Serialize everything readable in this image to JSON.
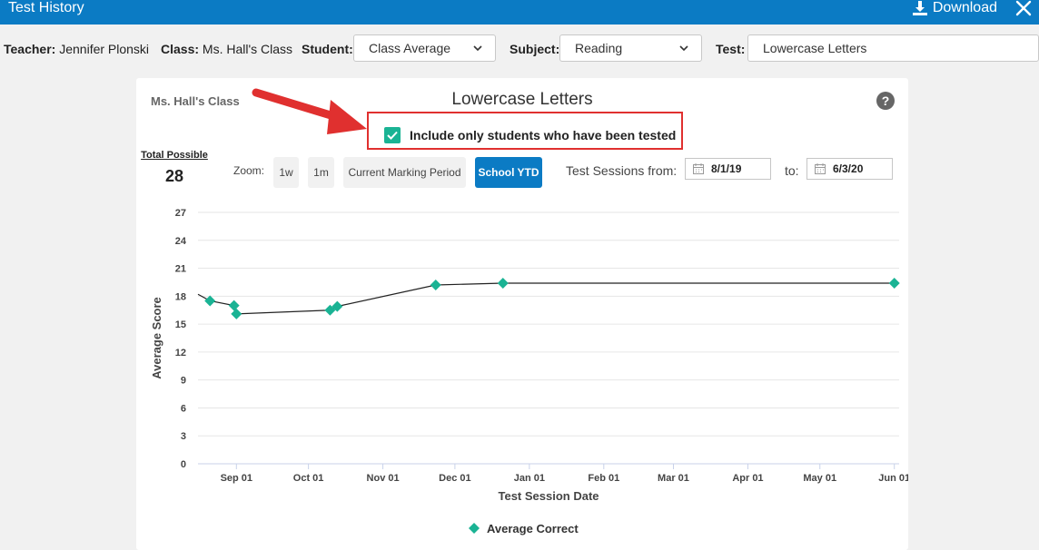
{
  "header": {
    "title": "Test History",
    "download_label": "Download"
  },
  "filters": {
    "teacher_label": "Teacher:",
    "teacher_value": "Jennifer Plonski",
    "class_label": "Class:",
    "class_value": "Ms. Hall's Class",
    "student_label": "Student:",
    "student_value": "Class Average",
    "subject_label": "Subject:",
    "subject_value": "Reading",
    "test_label": "Test:",
    "test_value": "Lowercase Letters"
  },
  "card": {
    "class_name": "Ms. Hall's Class",
    "title": "Lowercase Letters",
    "help": "?",
    "checkbox_label": "Include only students who have been tested",
    "checkbox_checked": true,
    "total_possible_label": "Total Possible",
    "total_possible_value": "28",
    "zoom_label": "Zoom:",
    "zoom_buttons": [
      "1w",
      "1m",
      "Current Marking Period",
      "School YTD"
    ],
    "active_zoom": "School YTD",
    "sessions_from_label": "Test Sessions from:",
    "from_date": "8/1/19",
    "to_label": "to:",
    "to_date": "6/3/20"
  },
  "colors": {
    "header_blue": "#0b7bc4",
    "marker_teal": "#1ab394",
    "annotation_red": "#e0302f"
  },
  "icons": [
    "download-icon",
    "close-icon",
    "chevron-down-icon",
    "help-icon",
    "check-icon",
    "calendar-icon",
    "red-arrow-annotation"
  ],
  "chart_data": {
    "type": "line",
    "xlabel": "Test Session Date",
    "ylabel": "Average Score",
    "x_tick_labels": [
      "Sep 01",
      "Oct 01",
      "Nov 01",
      "Dec 01",
      "Jan 01",
      "Feb 01",
      "Mar 01",
      "Apr 01",
      "May 01",
      "Jun 01"
    ],
    "y_ticks": [
      0,
      3,
      6,
      9,
      12,
      15,
      18,
      21,
      24,
      27
    ],
    "ylim": [
      0,
      27
    ],
    "xlim": [
      "2019-08-16",
      "2020-06-03"
    ],
    "grid": true,
    "legend": "bottom",
    "series": [
      {
        "name": "Average Correct",
        "x": [
          "2019-08-08",
          "2019-08-21",
          "2019-08-31",
          "2019-09-01",
          "2019-10-10",
          "2019-10-13",
          "2019-11-23",
          "2019-12-21",
          "2020-06-01"
        ],
        "y": [
          18.2,
          17.5,
          17.0,
          16.1,
          16.5,
          16.9,
          19.2,
          19.4,
          19.4
        ],
        "markers": [
          false,
          true,
          true,
          true,
          true,
          true,
          true,
          true,
          true
        ]
      }
    ]
  }
}
